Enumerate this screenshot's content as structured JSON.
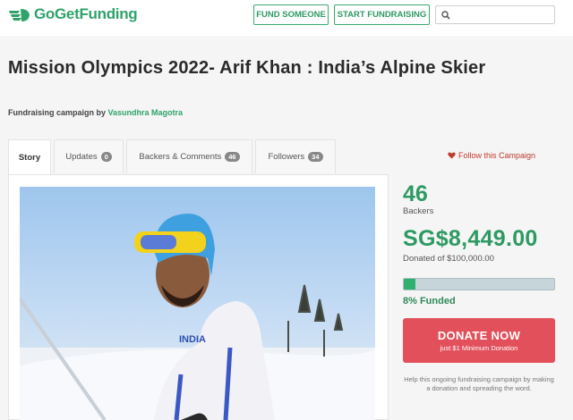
{
  "header": {
    "logo_text": "GoGetFunding",
    "fund_someone": "FUND SOMEONE",
    "start_fundraising": "START FUNDRAISING",
    "search_placeholder": ""
  },
  "campaign": {
    "title": "Mission Olympics 2022- Arif Khan : India’s Alpine Skier",
    "byline_prefix": "Fundraising campaign by",
    "organizer": "Vasundhra Magotra"
  },
  "tabs": [
    {
      "label": "Story",
      "count": ""
    },
    {
      "label": "Updates",
      "count": "0"
    },
    {
      "label": "Backers & Comments",
      "count": "46"
    },
    {
      "label": "Followers",
      "count": "34"
    }
  ],
  "follow_label": "Follow this Campaign",
  "stats": {
    "backers_count": "46",
    "backers_label": "Backers",
    "raised": "SG$8,449.00",
    "goal_text": "Donated of $100,000.00",
    "funded_fraction": 0.08,
    "funded_text": "8% Funded"
  },
  "donate": {
    "label": "DONATE NOW",
    "sublabel": "just $1 Minimum Donation"
  },
  "help_text": "Help this ongoing fundraising campaign by making a donation and spreading the word.",
  "photo": {
    "jersey_text": "INDIA"
  },
  "colors": {
    "brand": "#2e9a63",
    "donate": "#e2515b",
    "heart": "#c0392b"
  }
}
